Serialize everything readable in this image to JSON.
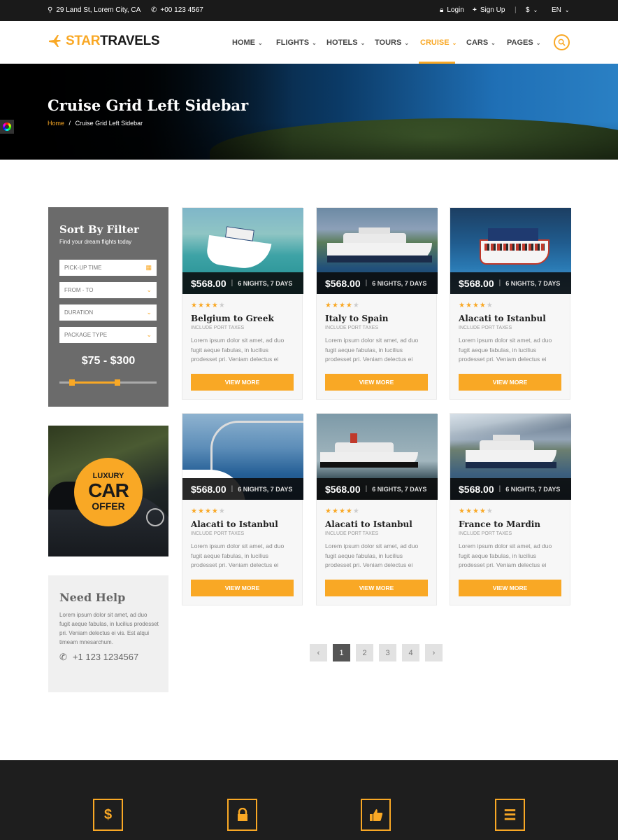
{
  "topbar": {
    "address": "29 Land St, Lorem City, CA",
    "phone": "+00 123 4567",
    "login": "Login",
    "signup": "Sign Up",
    "currency": "$",
    "language": "EN"
  },
  "brand": {
    "part1": "STAR",
    "part2": "TRAVELS",
    "accent": "#f9a825"
  },
  "nav": [
    {
      "label": "HOME"
    },
    {
      "label": "FLIGHTS"
    },
    {
      "label": "HOTELS"
    },
    {
      "label": "TOURS"
    },
    {
      "label": "CRUISE",
      "active": true
    },
    {
      "label": "CARS"
    },
    {
      "label": "PAGES"
    }
  ],
  "banner": {
    "title": "Cruise Grid Left Sidebar",
    "crumb_home": "Home",
    "crumb_sep": "/",
    "crumb_current": "Cruise Grid Left Sidebar"
  },
  "filter": {
    "title": "Sort By Filter",
    "subtitle": "Find your dream flights today",
    "fields": [
      "PICK-UP TIME",
      "FROM - TO",
      "DURATION",
      "PACKAGE TYPE"
    ],
    "price_range": "$75 - $300",
    "slider_min": 0.13,
    "slider_max": 0.6
  },
  "promo": {
    "line1": "LUXURY",
    "line2": "CAR",
    "line3": "OFFER"
  },
  "help": {
    "title": "Need Help",
    "text": "Lorem ipsum dolor sit amet, ad duo fugit aeque fabulas, in lucilius prodesset pri. Veniam delectus ei vis. Est atqui timeam mnesarchum.",
    "phone": "+1 123 1234567"
  },
  "cards": [
    {
      "price": "$568.00",
      "duration": "6 NIGHTS, 7 DAYS",
      "rating": 4,
      "title": "Belgium to Greek",
      "subtitle": "INCLUDE PORT TAXES",
      "desc": "Lorem ipsum dolor sit amet, ad duo fugit aeque fabulas, in lucilius prodesset pri. Veniam delectus ei",
      "button": "VIEW MORE"
    },
    {
      "price": "$568.00",
      "duration": "6 NIGHTS, 7 DAYS",
      "rating": 4,
      "title": "Italy to Spain",
      "subtitle": "INCLUDE PORT TAXES",
      "desc": "Lorem ipsum dolor sit amet, ad duo fugit aeque fabulas, in lucilius prodesset pri. Veniam delectus ei",
      "button": "VIEW MORE"
    },
    {
      "price": "$568.00",
      "duration": "6 NIGHTS, 7 DAYS",
      "rating": 4,
      "title": "Alacati to Istanbul",
      "subtitle": "INCLUDE PORT TAXES",
      "desc": "Lorem ipsum dolor sit amet, ad duo fugit aeque fabulas, in lucilius prodesset pri. Veniam delectus ei",
      "button": "VIEW MORE"
    },
    {
      "price": "$568.00",
      "duration": "6 NIGHTS, 7 DAYS",
      "rating": 4,
      "title": "Alacati to Istanbul",
      "subtitle": "INCLUDE PORT TAXES",
      "desc": "Lorem ipsum dolor sit amet, ad duo fugit aeque fabulas, in lucilius prodesset pri. Veniam delectus ei",
      "button": "VIEW MORE"
    },
    {
      "price": "$568.00",
      "duration": "6 NIGHTS, 7 DAYS",
      "rating": 4,
      "title": "Alacati to Istanbul",
      "subtitle": "INCLUDE PORT TAXES",
      "desc": "Lorem ipsum dolor sit amet, ad duo fugit aeque fabulas, in lucilius prodesset pri. Veniam delectus ei",
      "button": "VIEW MORE"
    },
    {
      "price": "$568.00",
      "duration": "6 NIGHTS, 7 DAYS",
      "rating": 4,
      "title": "France to Mardin",
      "subtitle": "INCLUDE PORT TAXES",
      "desc": "Lorem ipsum dolor sit amet, ad duo fugit aeque fabulas, in lucilius prodesset pri. Veniam delectus ei",
      "button": "VIEW MORE"
    }
  ],
  "pagination": {
    "prev": "‹",
    "pages": [
      "1",
      "2",
      "3",
      "4"
    ],
    "current": "1",
    "next": "›"
  },
  "footer_icons": [
    {
      "icon": "dollar-icon",
      "glyph": "$"
    },
    {
      "icon": "lock-icon",
      "glyph": "🔒"
    },
    {
      "icon": "thumbs-up-icon",
      "glyph": "👍"
    },
    {
      "icon": "menu-icon",
      "glyph": "☰"
    }
  ]
}
